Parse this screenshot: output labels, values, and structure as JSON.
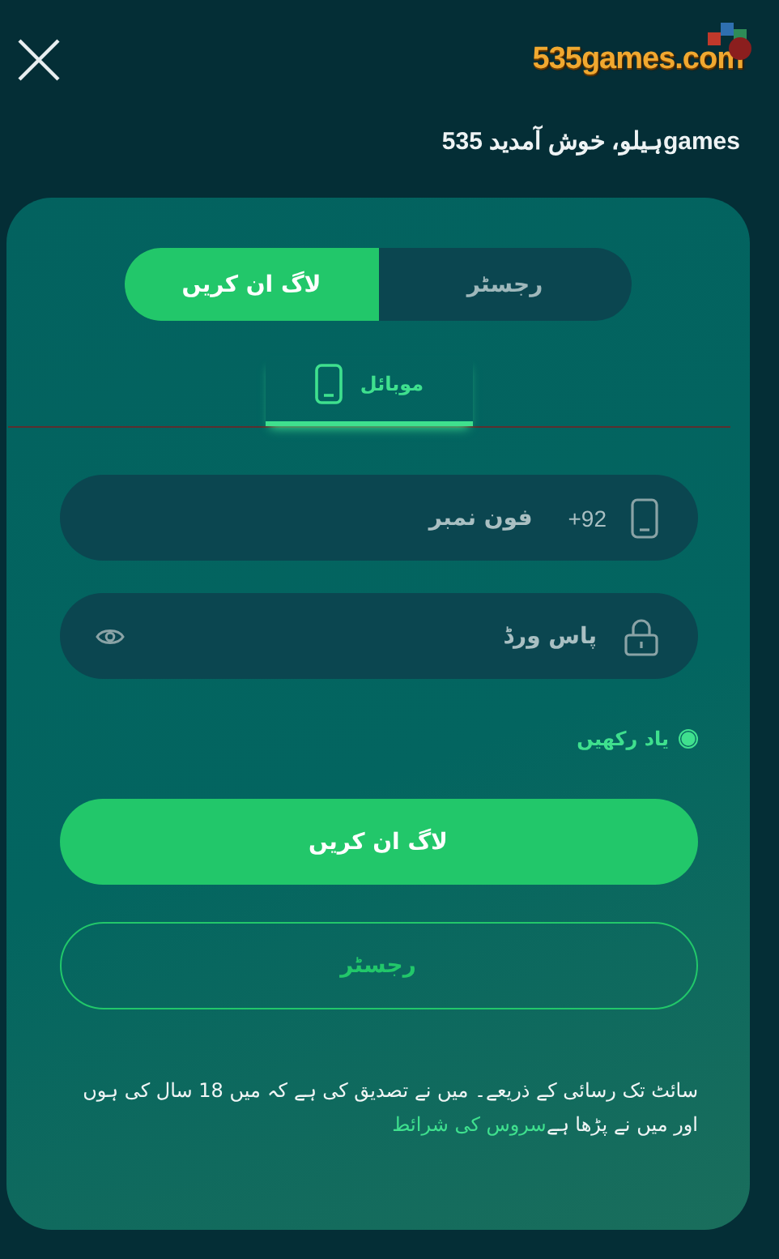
{
  "header": {
    "logo": "535games.com",
    "greeting": "gamesہیلو، خوش آمدید 535"
  },
  "mode_tabs": [
    {
      "label": "رجسٹر",
      "selected": false
    },
    {
      "label": "لاگ ان کریں",
      "selected": true
    }
  ],
  "method_tabs": [
    {
      "label": "موبائل",
      "selected": true
    }
  ],
  "fields": [
    {
      "kind": "phone",
      "prefix": "+92",
      "placeholder": "فون نمبر"
    },
    {
      "kind": "password",
      "placeholder": "پاس ورڈ"
    }
  ],
  "remember": {
    "label": "یاد رکھیں",
    "checked": true
  },
  "buttons": [
    {
      "kind": "primary",
      "label": "لاگ ان کریں"
    },
    {
      "kind": "outline",
      "label": "رجسٹر"
    }
  ],
  "terms": {
    "text": "سائٹ تک رسائی کے ذریعے۔ میں نے تصدیق کی ہے کہ میں 18 سال کی ہوں اور میں نے پڑھا ہے",
    "link": "سروس کی شرائط"
  }
}
